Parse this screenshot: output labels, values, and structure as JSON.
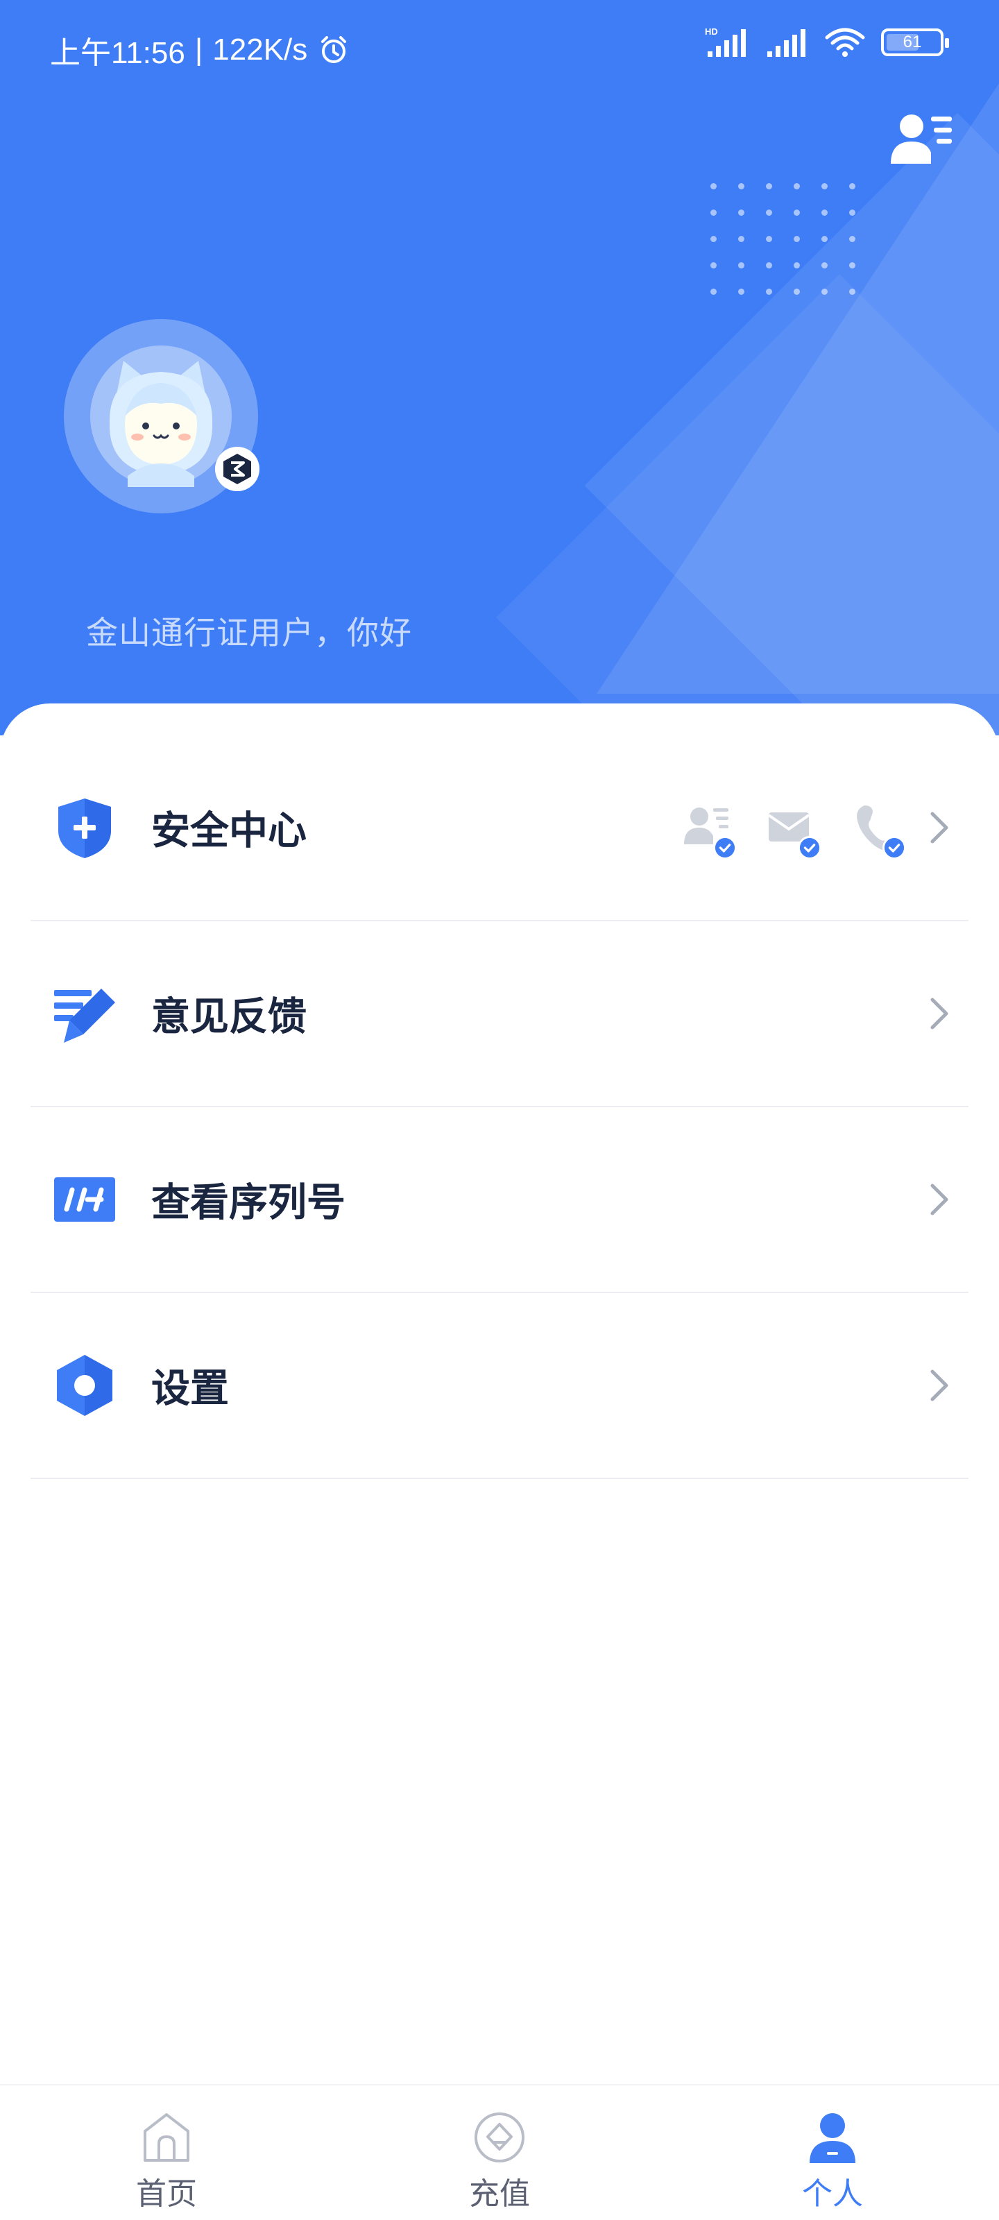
{
  "status_bar": {
    "time": "上午11:56",
    "separator": "|",
    "net_speed": "122K/s",
    "battery_level": "61",
    "icons": [
      "alarm-icon",
      "hd-icon",
      "signal-icon",
      "signal-icon",
      "wifi-icon",
      "battery-icon"
    ]
  },
  "header": {
    "profile_menu_icon": "user-list-icon",
    "greeting": "金山通行证用户，你好"
  },
  "menu": {
    "items": [
      {
        "id": "security",
        "label": "安全中心",
        "icon": "shield-plus-icon"
      },
      {
        "id": "feedback",
        "label": "意见反馈",
        "icon": "pencil-edit-icon"
      },
      {
        "id": "serial",
        "label": "查看序列号",
        "icon": "serial-number-icon"
      },
      {
        "id": "settings",
        "label": "设置",
        "icon": "hexagon-gear-icon"
      }
    ],
    "security_bindings": [
      "id-card-verified-icon",
      "email-verified-icon",
      "phone-verified-icon"
    ]
  },
  "bottom_nav": {
    "items": [
      {
        "label": "首页",
        "icon": "home-icon",
        "active": false
      },
      {
        "label": "充值",
        "icon": "recharge-icon",
        "active": false
      },
      {
        "label": "个人",
        "icon": "person-icon",
        "active": true
      }
    ]
  },
  "colors": {
    "primary": "#3f7df6",
    "text_dark": "#1a2540",
    "text_muted": "#5b6072",
    "divider": "#ebedf2",
    "chevron": "#a6abb8"
  }
}
